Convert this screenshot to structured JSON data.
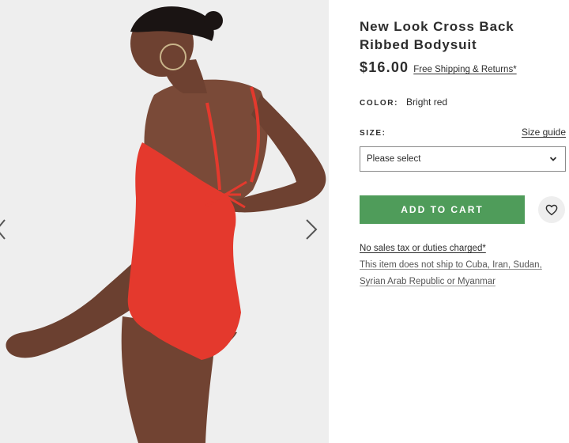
{
  "product": {
    "title": "New Look Cross Back Ribbed Bodysuit",
    "price": "$16.00",
    "shipping_link": "Free Shipping & Returns*",
    "image_alt": "Model wearing bright red cross back ribbed bodysuit"
  },
  "colour": {
    "label": "COLOR:",
    "value": "Bright red"
  },
  "size": {
    "label": "SIZE:",
    "guide_link": "Size guide",
    "selected": "Please select"
  },
  "actions": {
    "add_to_cart": "ADD TO CART"
  },
  "notes": {
    "tax": "No sales tax or duties charged*",
    "shipping_line1": "This item does not ship to Cuba, Iran, Sudan,",
    "shipping_line2": "Syrian Arab Republic or Myanmar"
  },
  "colors": {
    "add_to_cart_bg": "#4f9c5a",
    "product": "#e4392d",
    "gallery_bg": "#eeeeee",
    "text": "#2d2d2d"
  },
  "icons": {
    "next": "chevron-right-icon",
    "previous": "chevron-left-icon",
    "select": "chevron-down-icon",
    "save": "heart-icon"
  }
}
